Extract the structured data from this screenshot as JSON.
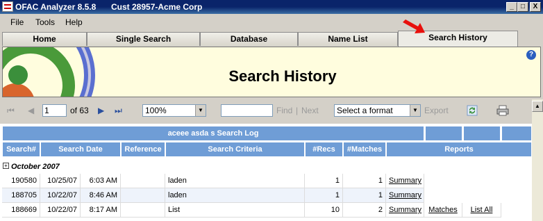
{
  "window": {
    "app_title": "OFAC Analyzer 8.5.8",
    "customer": "Cust 28957-Acme Corp",
    "min_btn": "_",
    "max_btn": "□",
    "close_btn": "X"
  },
  "menu": [
    "File",
    "Tools",
    "Help"
  ],
  "tabs": [
    "Home",
    "Single Search",
    "Database",
    "Name List",
    "Search History"
  ],
  "active_tab": "Search History",
  "banner": {
    "title": "Search History",
    "help_icon": "?"
  },
  "toolbar": {
    "page": "1",
    "of_pages": "of 63",
    "zoom": "100%",
    "find_label": "Find",
    "separator": "|",
    "next_label": "Next",
    "format_placeholder": "Select a format",
    "export_label": "Export"
  },
  "report": {
    "log_title": "aceee asda s Search Log",
    "columns": [
      "Search#",
      "Search Date",
      "Reference",
      "Search Criteria",
      "#Recs",
      "#Matches",
      "Reports"
    ],
    "group_toggle": "+",
    "group": "October 2007",
    "rows": [
      {
        "id": "190580",
        "date": "10/25/07",
        "time": "6:03 AM",
        "reference": "",
        "criteria": "laden",
        "recs": "1",
        "matches": "1",
        "summary": "Summary",
        "matches_link": "",
        "listall": ""
      },
      {
        "id": "188705",
        "date": "10/22/07",
        "time": "8:46 AM",
        "reference": "",
        "criteria": "laden",
        "recs": "1",
        "matches": "1",
        "summary": "Summary",
        "matches_link": "",
        "listall": ""
      },
      {
        "id": "188669",
        "date": "10/22/07",
        "time": "8:17 AM",
        "reference": "",
        "criteria": "List",
        "recs": "10",
        "matches": "2",
        "summary": "Summary",
        "matches_link": "Matches",
        "listall": "List All"
      }
    ]
  },
  "colors": {
    "header_blue": "#6f9dd6",
    "banner_bg": "#fffdde",
    "arrow_red": "#e8100c"
  }
}
